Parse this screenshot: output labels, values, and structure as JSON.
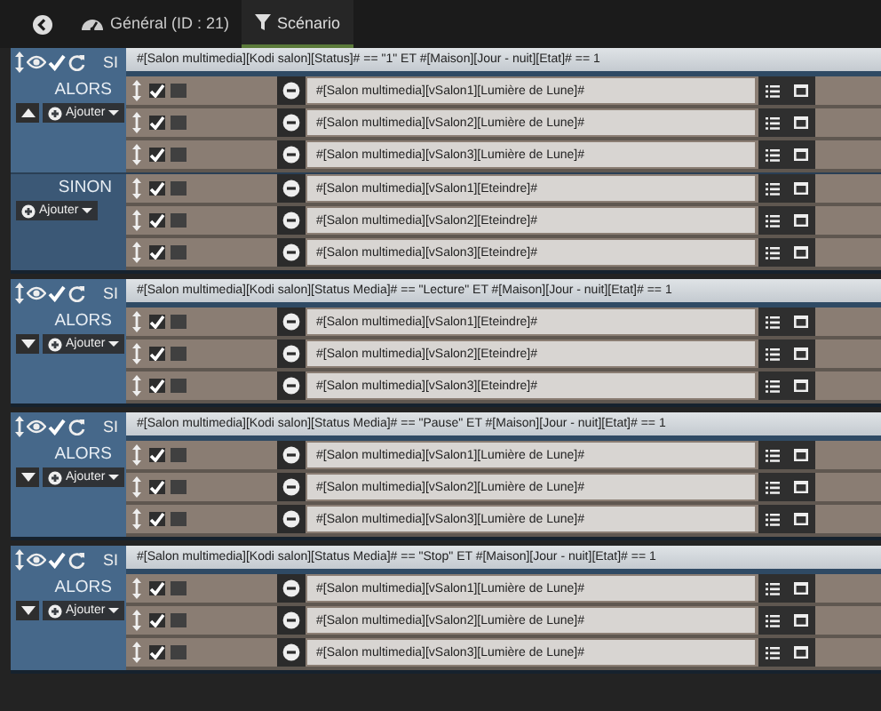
{
  "tabs": [
    {
      "label": "Général (ID : 21)",
      "selected": false
    },
    {
      "label": "Scénario",
      "selected": true
    }
  ],
  "blocks": [
    {
      "keyword": "SI",
      "condition": "#[Salon multimedia][Kodi salon][Status]# == \"1\"  ET #[Maison][Jour - nuit][Etat]# == 1",
      "sections": [
        {
          "label": "ALORS",
          "toggle_up": true,
          "button": "Ajouter",
          "actions": [
            {
              "text": "#[Salon multimedia][vSalon1][Lumière de Lune]#",
              "enabled": true,
              "parallel": false
            },
            {
              "text": "#[Salon multimedia][vSalon2][Lumière de Lune]#",
              "enabled": true,
              "parallel": false
            },
            {
              "text": "#[Salon multimedia][vSalon3][Lumière de Lune]#",
              "enabled": true,
              "parallel": false
            }
          ]
        },
        {
          "label": "SINON",
          "button": "Ajouter",
          "actions": [
            {
              "text": "#[Salon multimedia][vSalon1][Eteindre]#",
              "enabled": true,
              "parallel": false
            },
            {
              "text": "#[Salon multimedia][vSalon2][Eteindre]#",
              "enabled": true,
              "parallel": false
            },
            {
              "text": "#[Salon multimedia][vSalon3][Eteindre]#",
              "enabled": true,
              "parallel": false
            }
          ]
        }
      ]
    },
    {
      "keyword": "SI",
      "condition": "#[Salon multimedia][Kodi salon][Status Media]# == \"Lecture\"  ET #[Maison][Jour - nuit][Etat]# == 1",
      "sections": [
        {
          "label": "ALORS",
          "toggle_up": false,
          "button": "Ajouter",
          "actions": [
            {
              "text": "#[Salon multimedia][vSalon1][Eteindre]#",
              "enabled": true,
              "parallel": false
            },
            {
              "text": "#[Salon multimedia][vSalon2][Eteindre]#",
              "enabled": true,
              "parallel": false
            },
            {
              "text": "#[Salon multimedia][vSalon3][Eteindre]#",
              "enabled": true,
              "parallel": false
            }
          ]
        }
      ]
    },
    {
      "keyword": "SI",
      "condition": "#[Salon multimedia][Kodi salon][Status Media]# == \"Pause\"  ET #[Maison][Jour - nuit][Etat]# == 1",
      "sections": [
        {
          "label": "ALORS",
          "toggle_up": false,
          "button": "Ajouter",
          "actions": [
            {
              "text": "#[Salon multimedia][vSalon1][Lumière de Lune]#",
              "enabled": true,
              "parallel": false
            },
            {
              "text": "#[Salon multimedia][vSalon2][Lumière de Lune]#",
              "enabled": true,
              "parallel": false
            },
            {
              "text": "#[Salon multimedia][vSalon3][Lumière de Lune]#",
              "enabled": true,
              "parallel": false
            }
          ]
        }
      ]
    },
    {
      "keyword": "SI",
      "condition": "#[Salon multimedia][Kodi salon][Status Media]# == \"Stop\"  ET #[Maison][Jour - nuit][Etat]# == 1",
      "sections": [
        {
          "label": "ALORS",
          "toggle_up": false,
          "button": "Ajouter",
          "actions": [
            {
              "text": "#[Salon multimedia][vSalon1][Lumière de Lune]#",
              "enabled": true,
              "parallel": false
            },
            {
              "text": "#[Salon multimedia][vSalon2][Lumière de Lune]#",
              "enabled": true,
              "parallel": false
            },
            {
              "text": "#[Salon multimedia][vSalon3][Lumière de Lune]#",
              "enabled": true,
              "parallel": false
            }
          ]
        }
      ]
    }
  ]
}
